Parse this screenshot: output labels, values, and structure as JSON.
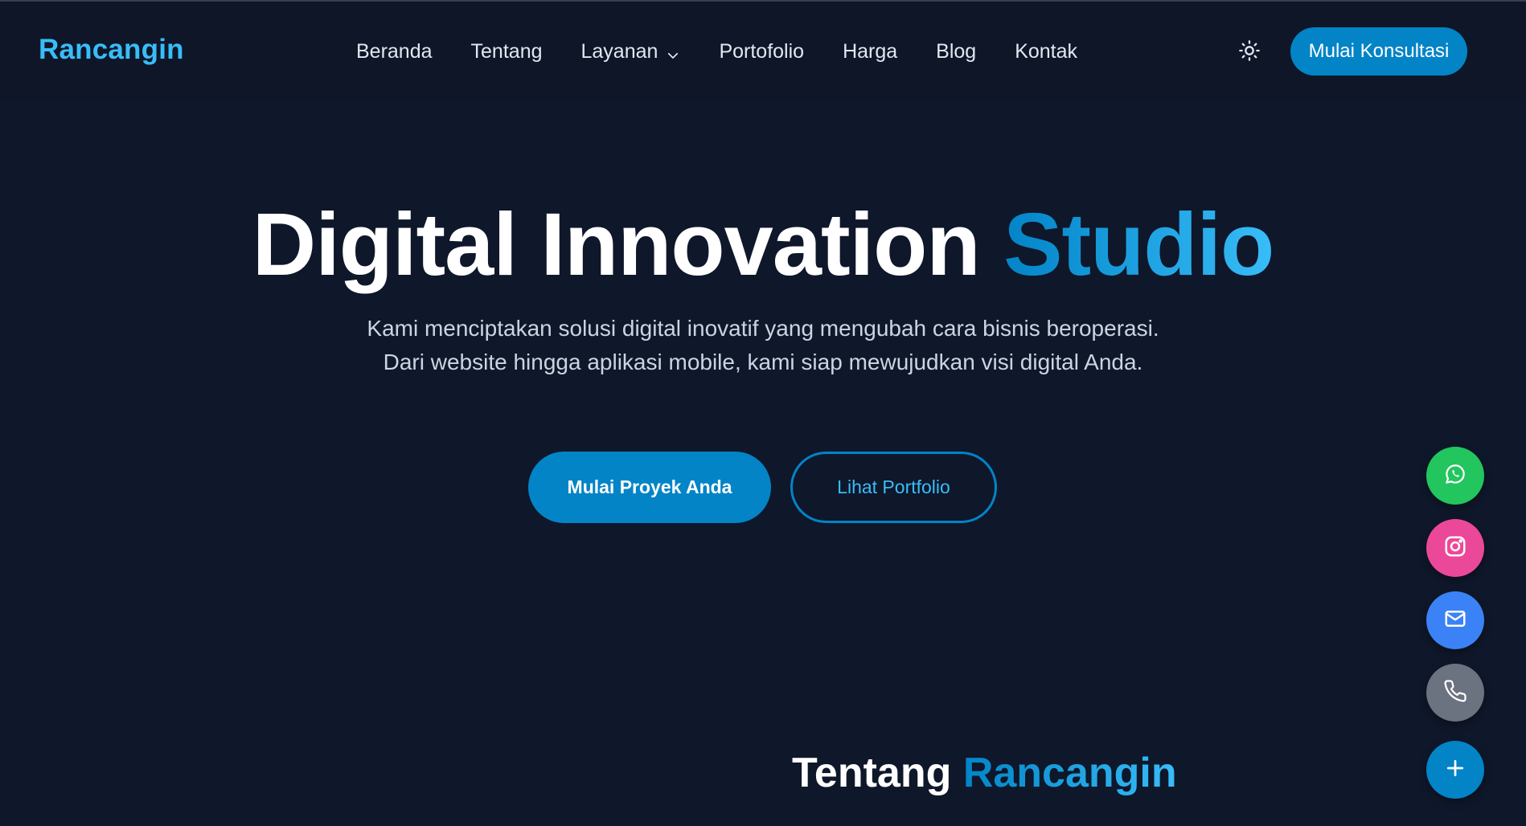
{
  "brand": {
    "name": "Rancangin",
    "color": "#38bdf8"
  },
  "nav": {
    "items": [
      {
        "label": "Beranda"
      },
      {
        "label": "Tentang"
      },
      {
        "label": "Layanan",
        "has_dropdown": true
      },
      {
        "label": "Portofolio"
      },
      {
        "label": "Harga"
      },
      {
        "label": "Blog"
      },
      {
        "label": "Kontak"
      }
    ],
    "theme_toggle_icon": "sun-icon",
    "cta_label": "Mulai Konsultasi"
  },
  "hero": {
    "title_main": "Digital Innovation",
    "title_accent": "Studio",
    "subtitle": "Kami menciptakan solusi digital inovatif yang mengubah cara bisnis beroperasi. Dari website hingga aplikasi mobile, kami siap mewujudkan visi digital Anda.",
    "primary_button": "Mulai Proyek Anda",
    "secondary_button": "Lihat Portfolio"
  },
  "about": {
    "title_main": "Tentang",
    "title_accent": "Rancangin"
  },
  "floating_actions": [
    {
      "icon": "whatsapp-icon",
      "color": "#22c55e"
    },
    {
      "icon": "instagram-icon",
      "color": "#ec4899"
    },
    {
      "icon": "mail-icon",
      "color": "#3b82f6"
    },
    {
      "icon": "phone-icon",
      "color": "#6b7280"
    },
    {
      "icon": "plus-icon",
      "color": "#0284c7"
    }
  ],
  "colors": {
    "background": "#0f172a",
    "header": "#0e1628",
    "accent": "#0284c7",
    "accent_light": "#38bdf8"
  }
}
